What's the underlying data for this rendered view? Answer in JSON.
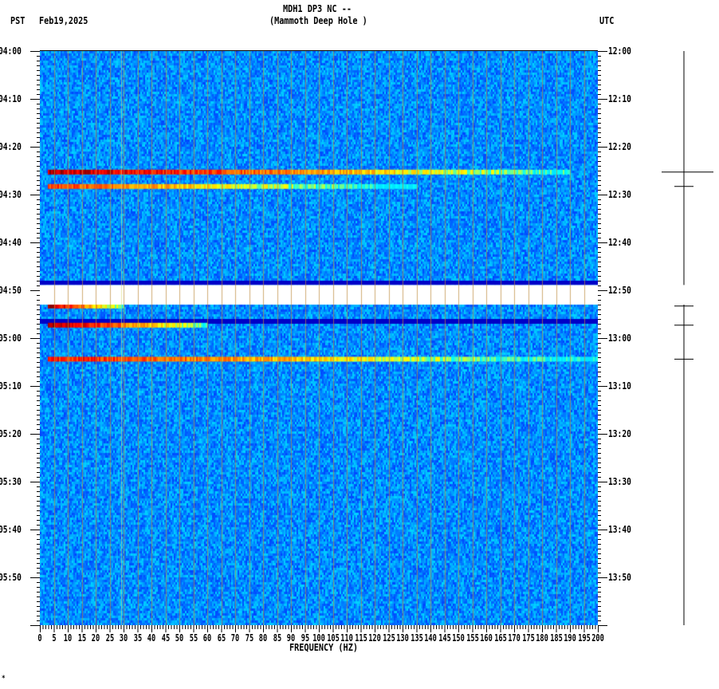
{
  "header": {
    "title_line1": "MDH1 DP3 NC --",
    "title_line2": "(Mammoth Deep Hole )",
    "left_tz": "PST",
    "date": "Feb19,2025",
    "right_tz": "UTC"
  },
  "footer_mark": "*",
  "chart_data": {
    "type": "heatmap",
    "title": "MDH1 DP3 NC -- (Mammoth Deep Hole )",
    "xlabel": "FREQUENCY (HZ)",
    "xlim": [
      0,
      200
    ],
    "x_ticks": [
      "0",
      "5",
      "10",
      "15",
      "20",
      "25",
      "30",
      "35",
      "40",
      "45",
      "50",
      "55",
      "60",
      "65",
      "70",
      "75",
      "80",
      "85",
      "90",
      "95",
      "100",
      "105",
      "110",
      "115",
      "120",
      "125",
      "130",
      "135",
      "140",
      "145",
      "150",
      "155",
      "160",
      "165",
      "170",
      "175",
      "180",
      "185",
      "190",
      "195",
      "200"
    ],
    "y_range_minutes": [
      0,
      120
    ],
    "y_ticks_left": [
      "04:00",
      "04:10",
      "04:20",
      "04:30",
      "04:40",
      "04:50",
      "05:00",
      "05:10",
      "05:20",
      "05:30",
      "05:40",
      "05:50"
    ],
    "y_ticks_right": [
      "12:00",
      "12:10",
      "12:20",
      "12:30",
      "12:40",
      "12:50",
      "13:00",
      "13:10",
      "13:20",
      "13:30",
      "13:40",
      "13:50"
    ],
    "data_gap_minutes": [
      48.9,
      53.0
    ],
    "low_bands_minutes": [
      [
        48.0,
        48.9
      ],
      [
        56.0,
        57.0
      ]
    ],
    "events": [
      {
        "minute": 25.3,
        "max_hz": 190,
        "intensity": 0.95
      },
      {
        "minute": 28.3,
        "max_hz": 135,
        "intensity": 0.8
      },
      {
        "minute": 53.3,
        "max_hz": 30,
        "intensity": 1.0
      },
      {
        "minute": 57.3,
        "max_hz": 60,
        "intensity": 1.0
      },
      {
        "minute": 64.4,
        "max_hz": 200,
        "intensity": 0.85
      }
    ],
    "colormap": [
      "#000080",
      "#0000ff",
      "#0080ff",
      "#00ffff",
      "#ffff00",
      "#ff8000",
      "#ff0000",
      "#800000"
    ]
  }
}
